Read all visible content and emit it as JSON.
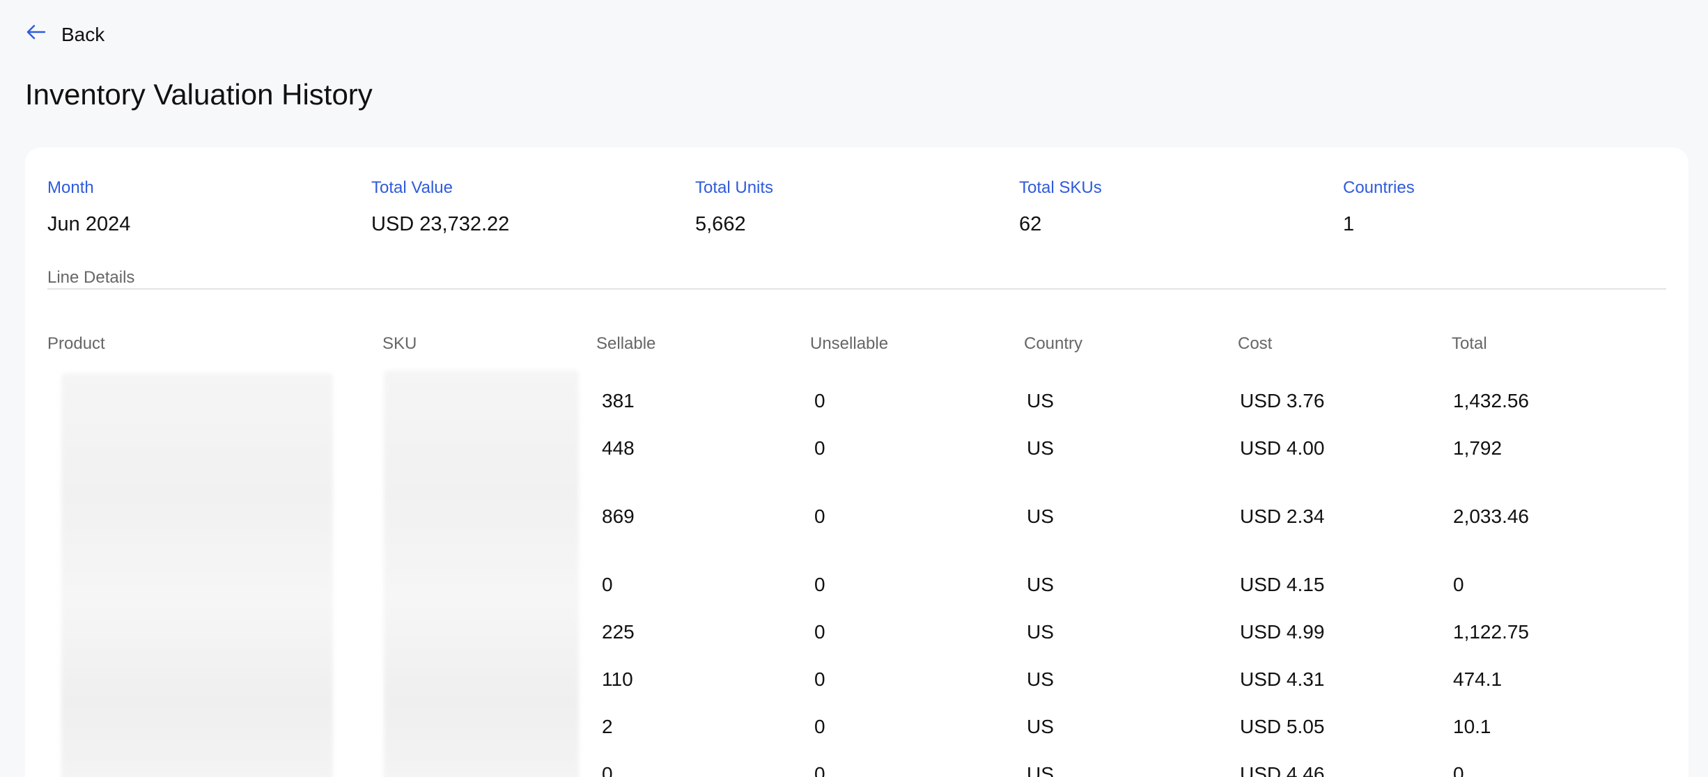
{
  "nav": {
    "back_label": "Back"
  },
  "page": {
    "title": "Inventory Valuation History"
  },
  "summary": {
    "month_label": "Month",
    "month_value": "Jun 2024",
    "total_value_label": "Total Value",
    "total_value": "USD 23,732.22",
    "total_units_label": "Total Units",
    "total_units": "5,662",
    "total_skus_label": "Total SKUs",
    "total_skus": "62",
    "countries_label": "Countries",
    "countries": "1"
  },
  "line_details": {
    "section_label": "Line Details",
    "columns": [
      "Product",
      "SKU",
      "Sellable",
      "Unsellable",
      "Country",
      "Cost",
      "Total"
    ],
    "rows": [
      {
        "sellable": "381",
        "unsellable": "0",
        "country": "US",
        "cost": "USD 3.76",
        "total": "1,432.56"
      },
      {
        "sellable": "448",
        "unsellable": "0",
        "country": "US",
        "cost": "USD 4.00",
        "total": "1,792"
      },
      {
        "sellable": "869",
        "unsellable": "0",
        "country": "US",
        "cost": "USD 2.34",
        "total": "2,033.46"
      },
      {
        "sellable": "0",
        "unsellable": "0",
        "country": "US",
        "cost": "USD 4.15",
        "total": "0"
      },
      {
        "sellable": "225",
        "unsellable": "0",
        "country": "US",
        "cost": "USD 4.99",
        "total": "1,122.75"
      },
      {
        "sellable": "110",
        "unsellable": "0",
        "country": "US",
        "cost": "USD 4.31",
        "total": "474.1"
      },
      {
        "sellable": "2",
        "unsellable": "0",
        "country": "US",
        "cost": "USD 5.05",
        "total": "10.1"
      },
      {
        "sellable": "0",
        "unsellable": "0",
        "country": "US",
        "cost": "USD 4.46",
        "total": "0"
      }
    ]
  },
  "icons": {
    "back": "arrow-left-icon"
  },
  "colors": {
    "accent": "#2f5bdc",
    "muted": "#666666",
    "background": "#f7f8fa"
  }
}
